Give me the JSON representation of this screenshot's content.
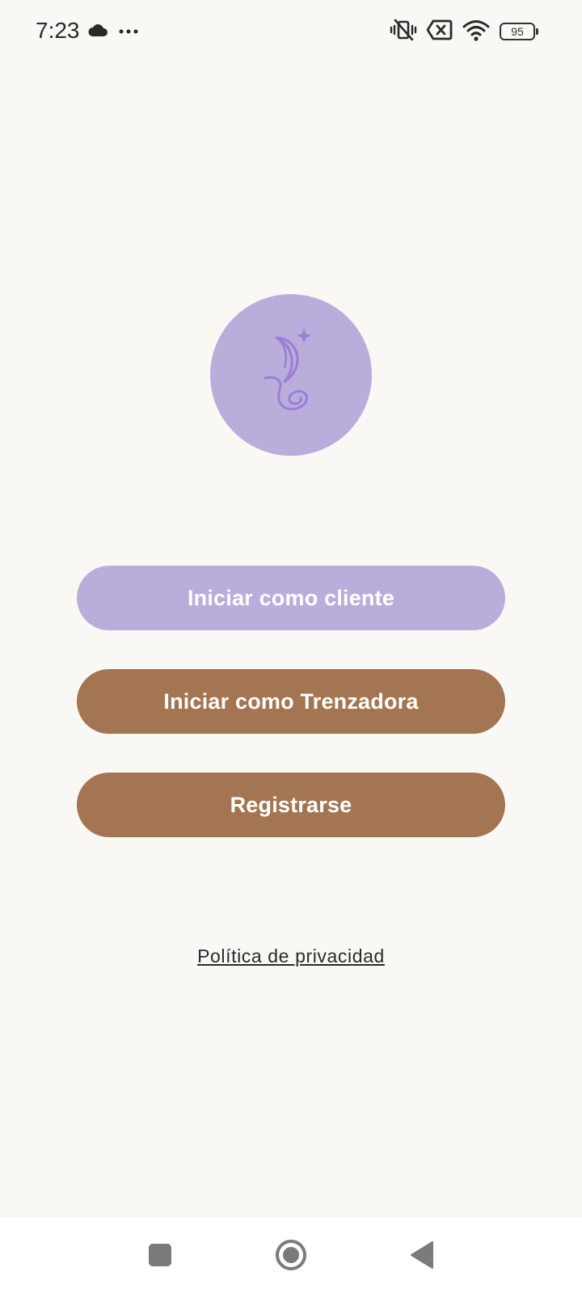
{
  "status_bar": {
    "time": "7:23",
    "icons_left": [
      "cloud-icon",
      "more-dots-icon"
    ],
    "icons_right": [
      "vibrate-off-icon",
      "no-sim-icon",
      "wifi-icon",
      "battery-icon"
    ],
    "battery_level": "95"
  },
  "logo": {
    "icon": "moon-braid-logo-icon",
    "background_color": "#b9aedb",
    "mark_color": "#9b7fd4"
  },
  "buttons": {
    "client_label": "Iniciar como cliente",
    "braider_label": "Iniciar como Trenzadora",
    "register_label": "Registrarse"
  },
  "links": {
    "privacy_label": "Política de privacidad"
  },
  "navigation_bar": {
    "icons": [
      "recents-square-icon",
      "home-circle-icon",
      "back-triangle-icon"
    ]
  },
  "colors": {
    "background": "#faf8f5",
    "primary_lavender": "#b9aedb",
    "primary_brown": "#a47552",
    "button_text": "#ffffff"
  }
}
